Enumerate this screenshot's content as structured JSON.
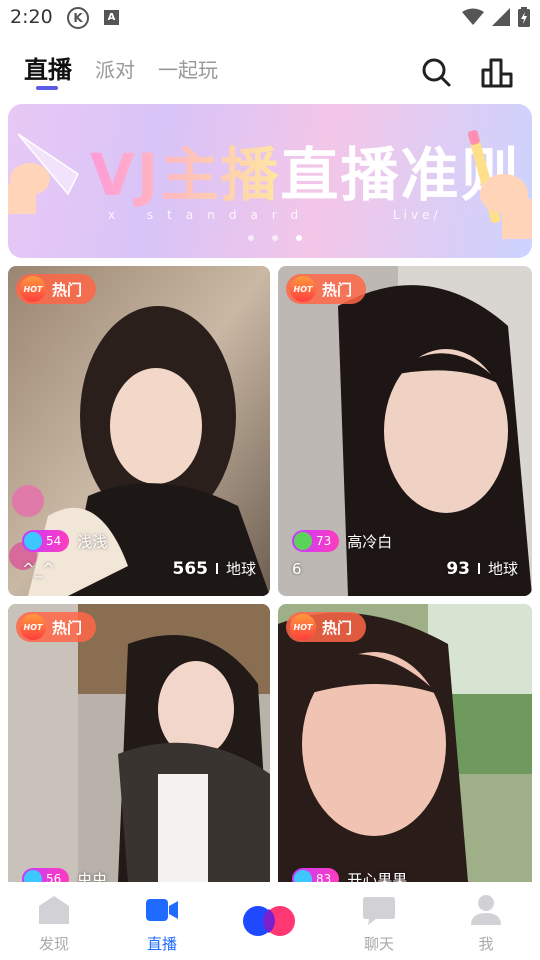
{
  "status": {
    "time": "2:20",
    "k_icon": "K",
    "a_icon": "A",
    "icons": [
      "wifi-icon",
      "signal-icon",
      "battery-icon"
    ]
  },
  "top_nav": {
    "tabs": [
      {
        "label": "直播",
        "active": true
      },
      {
        "label": "派对",
        "active": false
      },
      {
        "label": "一起玩",
        "active": false
      }
    ],
    "accent": "#5b5be8",
    "icons": [
      "search-icon",
      "ranking-icon"
    ]
  },
  "banner": {
    "title_part1": "VJ主播",
    "title_part2": "直播准则",
    "sub_left": "x standard",
    "sub_right": "Live/",
    "dots": 3,
    "active_dot": 3
  },
  "cards": [
    {
      "hot_icon": "HOT",
      "hot_label": "热门",
      "level": "54",
      "level_style": "blue",
      "host": "浅浅",
      "caption": "^_^",
      "count": "565",
      "location": "地球"
    },
    {
      "hot_icon": "HOT",
      "hot_label": "热门",
      "level": "73",
      "level_style": "green",
      "host": "高冷白",
      "caption": "6",
      "count": "93",
      "location": "地球"
    },
    {
      "hot_icon": "HOT",
      "hot_label": "热门",
      "level": "56",
      "level_style": "blue",
      "host": "虫虫",
      "caption": "",
      "count": "",
      "location": ""
    },
    {
      "hot_icon": "HOT",
      "hot_label": "热门",
      "level": "83",
      "level_style": "blue",
      "host": "开心果果",
      "caption": "",
      "count": "",
      "location": ""
    }
  ],
  "bottom_nav": {
    "items": [
      {
        "label": "发现",
        "icon": "discover-icon",
        "active": false
      },
      {
        "label": "直播",
        "icon": "video-camera-icon",
        "active": true
      },
      {
        "label": "聊天",
        "icon": "chat-bubble-icon",
        "active": false
      },
      {
        "label": "我",
        "icon": "person-icon",
        "active": false
      }
    ],
    "center_icon": "create-live-icon",
    "active_color": "#1f6bff"
  }
}
